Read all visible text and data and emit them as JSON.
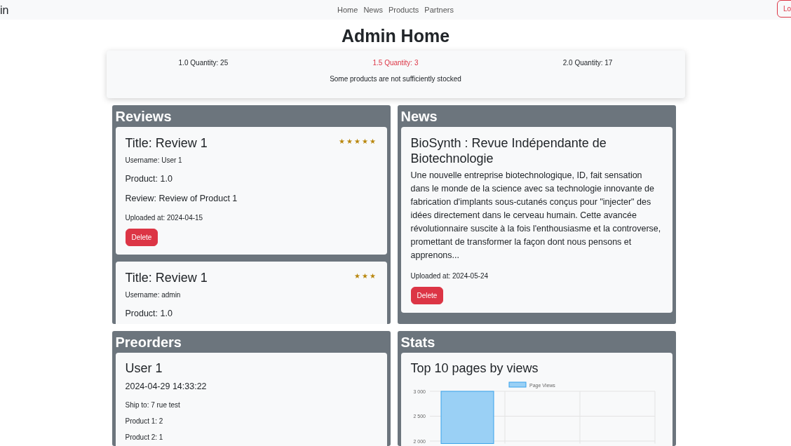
{
  "navbar": {
    "brand": "in",
    "links": [
      {
        "label": "Home"
      },
      {
        "label": "News"
      },
      {
        "label": "Products"
      },
      {
        "label": "Partners"
      }
    ],
    "login_button": "Lo"
  },
  "title": "Admin Home",
  "stock": {
    "items": [
      {
        "label": "1.0 Quantity: 25",
        "low": false
      },
      {
        "label": "1.5 Quantity: 3",
        "low": true
      },
      {
        "label": "2.0 Quantity: 17",
        "low": false
      }
    ],
    "message": "Some products are not sufficiently stocked"
  },
  "reviews": {
    "heading": "Reviews",
    "items": [
      {
        "title": "Title: Review 1",
        "username": "Username: User 1",
        "product": "Product: 1.0",
        "review": "Review: Review of Product 1",
        "uploaded": "Uploaded at: 2024-04-15",
        "button": "Delete",
        "stars": 5
      },
      {
        "title": "Title: Review 1",
        "username": "Username: admin",
        "product": "Product: 1.0",
        "stars": 3
      }
    ]
  },
  "news": {
    "heading": "News",
    "items": [
      {
        "title": "BioSynth : Revue Indépendante de Biotechnologie",
        "body": "Une nouvelle entreprise biotechnologique, ID, fait sensation dans le monde de la science avec sa technologie innovante de fabrication d'implants sous-cutanés conçus pour \"injecter\" des idées directement dans le cerveau humain. Cette avancée révolutionnaire suscite à la fois l'enthousiasme et la controverse, promettant de transformer la façon dont nous pensons et apprenons...",
        "uploaded": "Uploaded at: 2024-05-24",
        "button": "Delete"
      }
    ]
  },
  "preorders": {
    "heading": "Preorders",
    "items": [
      {
        "user": "User 1",
        "date": "2024-04-29 14:33:22",
        "lines": [
          "Ship to: 7 rue test",
          "Product 1: 2",
          "Product 2: 1"
        ]
      }
    ]
  },
  "stats": {
    "heading": "Stats",
    "chart_title": "Top 10 pages by views",
    "chart_data": {
      "type": "bar",
      "series": [
        {
          "name": "Page Views",
          "color": "#9ad0f5",
          "values": [
            3000
          ]
        }
      ],
      "ylim": [
        1950,
        3000
      ],
      "grid": true,
      "yticks": [
        {
          "value": 3000,
          "label": "3 000"
        },
        {
          "value": 2500,
          "label": "2 500"
        },
        {
          "value": 2000,
          "label": "2 000"
        }
      ]
    }
  }
}
